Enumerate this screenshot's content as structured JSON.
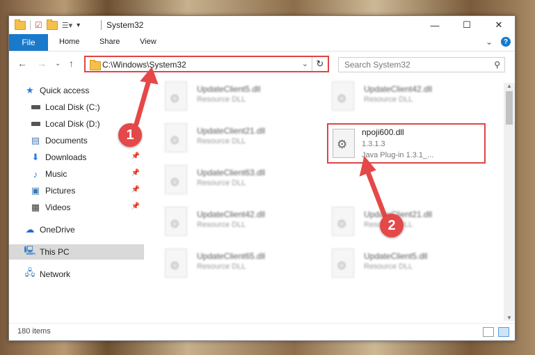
{
  "window": {
    "title": "System32",
    "controls": {
      "minimize": "—",
      "maximize": "☐",
      "close": "✕"
    }
  },
  "ribbon": {
    "tabs": [
      "File",
      "Home",
      "Share",
      "View"
    ],
    "collapse_glyph": "⌄",
    "help_glyph": "?"
  },
  "address": {
    "path": "C:\\Windows\\System32",
    "search_placeholder": "Search System32"
  },
  "sidebar": {
    "items": [
      {
        "label": "Quick access",
        "icon": "star-icon",
        "pinned": false
      },
      {
        "label": "Local Disk (C:)",
        "icon": "drive-icon",
        "pinned": false
      },
      {
        "label": "Local Disk (D:)",
        "icon": "drive-icon",
        "pinned": false
      },
      {
        "label": "Documents",
        "icon": "documents-icon",
        "pinned": true
      },
      {
        "label": "Downloads",
        "icon": "download-icon",
        "pinned": true
      },
      {
        "label": "Music",
        "icon": "music-icon",
        "pinned": true
      },
      {
        "label": "Pictures",
        "icon": "pictures-icon",
        "pinned": true
      },
      {
        "label": "Videos",
        "icon": "videos-icon",
        "pinned": true
      },
      {
        "label": "OneDrive",
        "icon": "cloud-icon",
        "pinned": false
      },
      {
        "label": "This PC",
        "icon": "pc-icon",
        "pinned": false,
        "selected": true
      },
      {
        "label": "Network",
        "icon": "network-icon",
        "pinned": false
      }
    ]
  },
  "files": {
    "left_column": [
      {
        "name": "UpdateClient5.dll",
        "type": "Resource DLL"
      },
      {
        "name": "UpdateClient21.dll",
        "type": "Resource DLL"
      },
      {
        "name": "UpdateClient63.dll",
        "type": "Resource DLL"
      },
      {
        "name": "UpdateClient42.dll",
        "type": "Resource DLL"
      },
      {
        "name": "UpdateClient65.dll",
        "type": "Resource DLL"
      }
    ],
    "right_column": [
      {
        "name": "UpdateClient42.dll",
        "type": "Resource DLL"
      },
      {
        "name": "UpdateClient21.dll",
        "type": "Resource DLL"
      },
      {
        "name": "UpdateClient5.dll",
        "type": "Resource DLL"
      }
    ],
    "highlighted": {
      "name": "npoji600.dll",
      "version": "1.3.1.3",
      "description": "Java Plug-in 1.3.1_..."
    }
  },
  "status": {
    "item_count": "180 items"
  },
  "annotations": {
    "step1": "1",
    "step2": "2",
    "color": "#e54848"
  }
}
